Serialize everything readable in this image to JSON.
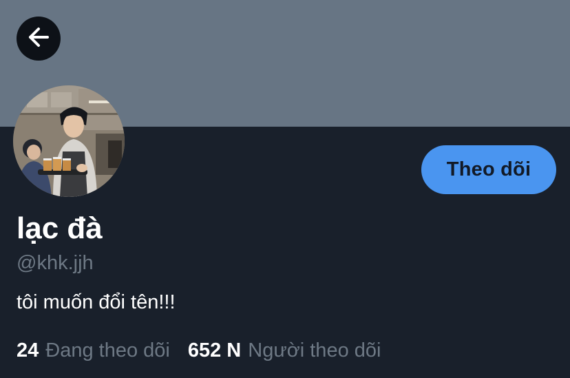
{
  "header": {
    "back_icon": "arrow-left-icon",
    "banner_color": "#677584"
  },
  "profile": {
    "display_name": "lạc đà",
    "handle": "@khk.jjh",
    "bio": "tôi muốn đổi tên!!!",
    "follow_label": "Theo dõi",
    "follow_color": "#4a95f0"
  },
  "stats": {
    "following_count": "24",
    "following_label": "Đang theo dõi",
    "followers_count": "652 N",
    "followers_label": "Người theo dõi"
  }
}
